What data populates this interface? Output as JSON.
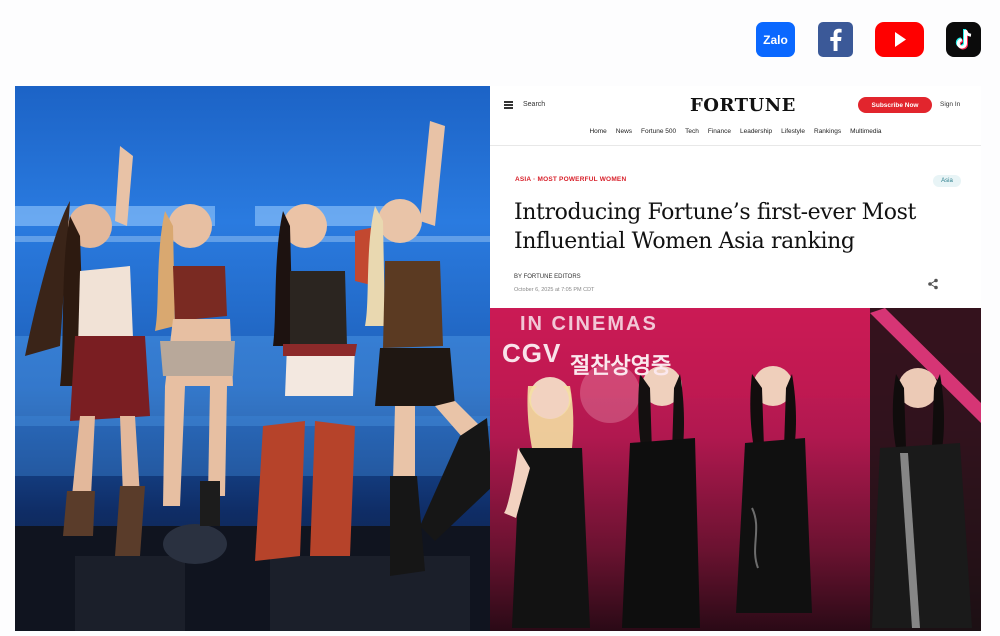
{
  "social": {
    "zalo_label": "Zalo",
    "icons": [
      "zalo-icon",
      "facebook-icon",
      "youtube-icon",
      "tiktok-icon"
    ],
    "colors": {
      "zalo": "#0a68ff",
      "facebook": "#3b5998",
      "youtube": "#ff0000",
      "tiktok": "#0b0b0b"
    }
  },
  "fortune": {
    "search_label": "Search",
    "logo": "FORTUNE",
    "subscribe_label": "Subscribe Now",
    "signin_label": "Sign In",
    "nav": [
      "Home",
      "News",
      "Fortune 500",
      "Tech",
      "Finance",
      "Leadership",
      "Lifestyle",
      "Rankings",
      "Multimedia"
    ],
    "kicker": "ASIA · MOST POWERFUL WOMEN",
    "badge": "Asia",
    "headline": "Introducing Fortune’s first-ever Most Influential Women Asia ranking",
    "byline": "BY FORTUNE EDITORS",
    "dateline": "October 6, 2025 at 7:05 PM CDT",
    "accent": "#e2252d"
  },
  "event_photo": {
    "banner_text": "IN CINEMAS",
    "brand_text": "CGV",
    "korean_text": "절찬상영중"
  }
}
